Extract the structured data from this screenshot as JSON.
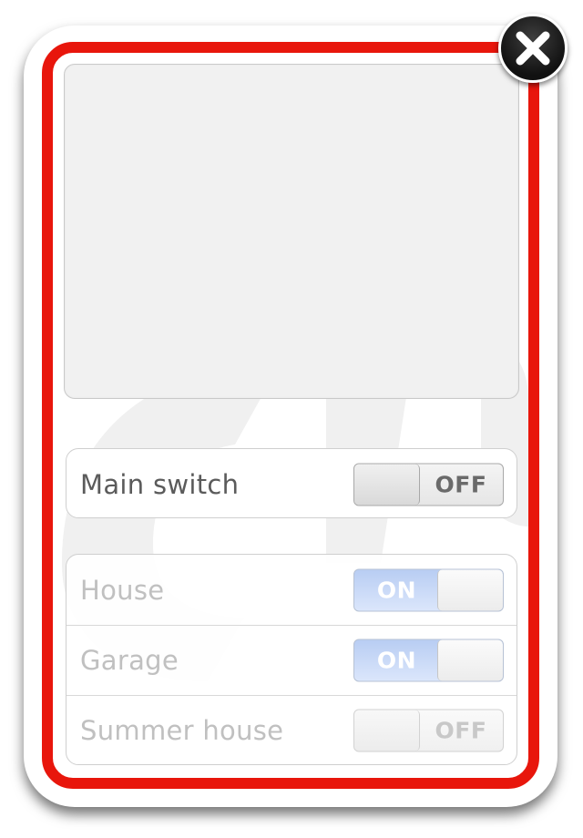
{
  "close": {
    "icon": "close-icon"
  },
  "main_switch": {
    "label": "Main switch",
    "state": "OFF"
  },
  "zones": [
    {
      "label": "House",
      "state": "ON"
    },
    {
      "label": "Garage",
      "state": "ON"
    },
    {
      "label": "Summer house",
      "state": "OFF"
    }
  ],
  "colors": {
    "frame_red": "#e8160c",
    "toggle_on": "#b8cdf3",
    "close_button": "#1a1a1a"
  }
}
